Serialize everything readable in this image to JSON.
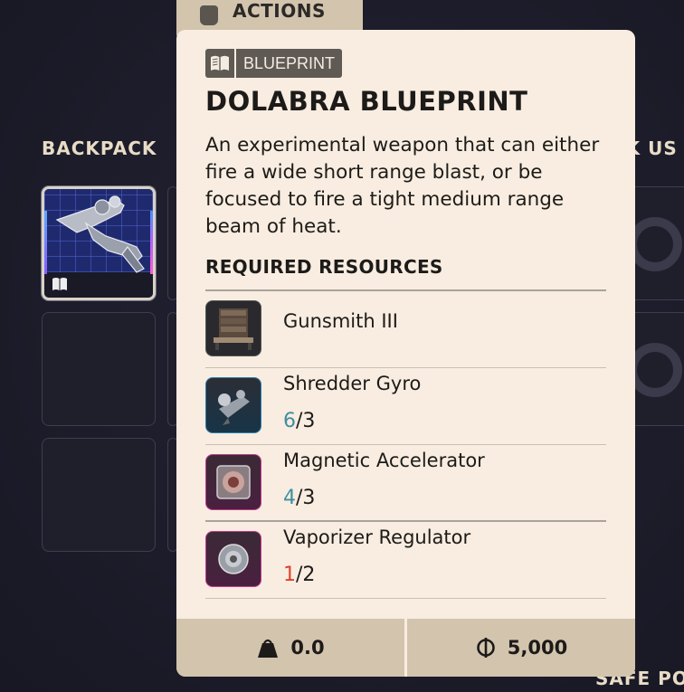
{
  "background": {
    "actions_tab": "ACTIONS",
    "backpack_title": "BACKPACK",
    "right_section_title": "CK US",
    "safe_pocket_title": "SAFE POC"
  },
  "tooltip": {
    "badge": {
      "icon": "book-icon",
      "label": "BLUEPRINT"
    },
    "title": "DOLABRA BLUEPRINT",
    "description": "An experimental weapon that can either fire a wide short range blast, or be focused to fire a tight medium range beam of heat.",
    "required_title": "REQUIRED RESOURCES",
    "resources": [
      {
        "name": "Gunsmith III",
        "have": "",
        "need": "",
        "status": "station"
      },
      {
        "name": "Shredder Gyro",
        "have": "6",
        "need": "/3",
        "status": "ok"
      },
      {
        "name": "Magnetic Accelerator",
        "have": "4",
        "need": "/3",
        "status": "ok"
      },
      {
        "name": "Vaporizer Regulator",
        "have": "1",
        "need": "/2",
        "status": "low"
      }
    ],
    "footer": {
      "weight": "0.0",
      "value": "5,000"
    }
  },
  "colors": {
    "tooltip_bg": "#f8ede0",
    "footer_bg": "#d3c4ae",
    "qty_ok": "#3f8ea2",
    "qty_low": "#e2402b",
    "rarity_blue": "#2f7fb0",
    "rarity_pink": "#c33a8f"
  }
}
